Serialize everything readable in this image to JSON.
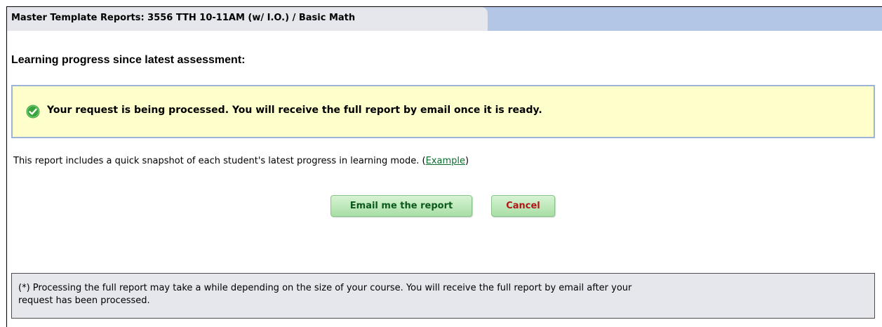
{
  "tab": {
    "title": "Master Template Reports: 3556 TTH 10-11AM (w/ I.O.) / Basic Math"
  },
  "heading": "Learning progress since latest assessment:",
  "notice": {
    "icon": "check-circle-icon",
    "message": "Your request is being processed. You will receive the full report by email once it is ready."
  },
  "snapshot": {
    "text_before": "This report includes a quick snapshot of each student's latest progress in learning mode. (",
    "link_text": "Example",
    "text_after": ")"
  },
  "buttons": {
    "email": "Email me the report",
    "cancel": "Cancel"
  },
  "footnote": {
    "line1": "(*) Processing the full report may take a while depending on the size of your course. You will receive the full report by email after your",
    "line2": "request has been processed."
  },
  "colors": {
    "tab_strip": "#b4c6e6",
    "tab": "#e5e7ec",
    "notice_bg": "#ffffcc",
    "notice_border": "#9fb2d8",
    "check_green": "#3aa43c",
    "link_green": "#0b6e2c",
    "cancel_red": "#b01818"
  }
}
